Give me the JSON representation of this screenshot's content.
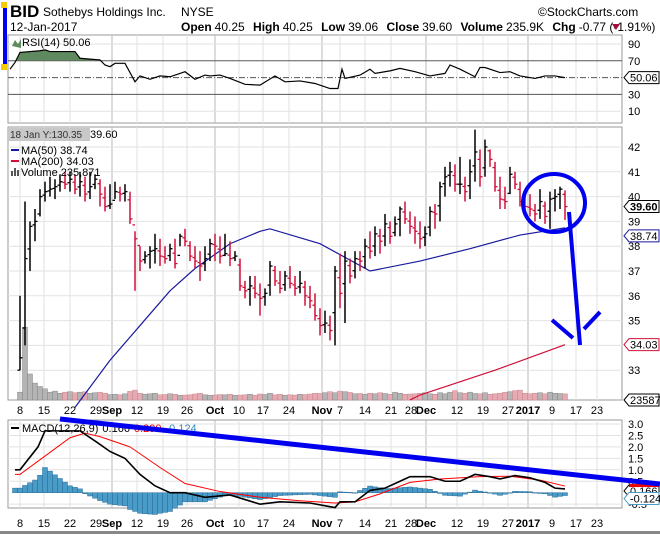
{
  "header": {
    "symbol": "BID",
    "company": "Sothebys Holdings Inc.",
    "exchange": "NYSE",
    "copyright": "©StockCharts.com",
    "date": "12-Jan-2017",
    "open_label": "Open",
    "open": "40.25",
    "high_label": "High",
    "high": "40.25",
    "low_label": "Low",
    "low": "39.06",
    "close_label": "Close",
    "close": "39.60",
    "volume_label": "Volume",
    "volume": "235.9K",
    "chg_label": "Chg",
    "chg": "-0.77 (-1.91%)",
    "chg_icon": "down-triangle-icon"
  },
  "tooltip": {
    "text": "18 Jan Y:130.35",
    "trail": "39.60"
  },
  "colors": {
    "up": "#000000",
    "down": "#d0103a",
    "ma50": "#1a1aa0",
    "ma200": "#d0103a",
    "macd": "#000000",
    "signal": "#ff0000",
    "hist": "#4a9cc8",
    "rsi_fill": "#5f8a5f",
    "annotation": "#0000ee"
  },
  "chart_data": [
    {
      "type": "line",
      "name": "rsi",
      "legend": "RSI(14) 50.06",
      "value_label": "50.06",
      "ylim": [
        0,
        100
      ],
      "yticks": [
        "90",
        "70",
        "50",
        "30",
        "10"
      ],
      "yvals": [
        90,
        70,
        50,
        30,
        10
      ],
      "overbought": 70,
      "oversold": 30,
      "points": [
        [
          -2,
          60
        ],
        [
          -1,
          68
        ],
        [
          0,
          80
        ],
        [
          4,
          82
        ],
        [
          5,
          83
        ],
        [
          6,
          81
        ],
        [
          11,
          81
        ],
        [
          12,
          73
        ],
        [
          14,
          72
        ],
        [
          16,
          71
        ],
        [
          17,
          65
        ],
        [
          18,
          63
        ],
        [
          19,
          67
        ],
        [
          21,
          67
        ],
        [
          23,
          45
        ],
        [
          24,
          52
        ],
        [
          26,
          48
        ],
        [
          28,
          52
        ],
        [
          30,
          51
        ],
        [
          32,
          55
        ],
        [
          33,
          57
        ],
        [
          35,
          48
        ],
        [
          37,
          53
        ],
        [
          38,
          52
        ],
        [
          40,
          53
        ],
        [
          42,
          49
        ],
        [
          45,
          42
        ],
        [
          48,
          41
        ],
        [
          51,
          52
        ],
        [
          53,
          45
        ],
        [
          56,
          46
        ],
        [
          59,
          43
        ],
        [
          62,
          37
        ],
        [
          63.6,
          37
        ],
        [
          64.4,
          60
        ],
        [
          65,
          49
        ],
        [
          68,
          53
        ],
        [
          70,
          60
        ],
        [
          71,
          55
        ],
        [
          74,
          58
        ],
        [
          76,
          61
        ],
        [
          79,
          57
        ],
        [
          82,
          52
        ],
        [
          85,
          55
        ],
        [
          86,
          65
        ],
        [
          88,
          60
        ],
        [
          91,
          51
        ],
        [
          92,
          62
        ],
        [
          93,
          62
        ],
        [
          96,
          56
        ],
        [
          98,
          57
        ],
        [
          100,
          52
        ],
        [
          103,
          49
        ],
        [
          105,
          52
        ],
        [
          107,
          52
        ],
        [
          109,
          50
        ]
      ]
    },
    {
      "type": "ohlc",
      "name": "price",
      "legend": {
        "ma50": "MA(50) 38.74",
        "ma200": "MA(200) 34.03",
        "volume": "Volume 235,871"
      },
      "ylim": [
        32.2,
        43
      ],
      "yticks": [
        "42",
        "41",
        "40",
        "39",
        "38",
        "37",
        "36",
        "35",
        "34",
        "33"
      ],
      "last_label": "39.60",
      "ma50_label": "38.74",
      "ma200_label": "34.03",
      "volume_label": "235871",
      "bars_hlc": [
        [
          36,
          33,
          33.5
        ],
        [
          39.8,
          34,
          37.5
        ],
        [
          39,
          37,
          38.8
        ],
        [
          39.5,
          38.2,
          39
        ],
        [
          40.3,
          39.2,
          40
        ],
        [
          40.6,
          39.8,
          40.2
        ],
        [
          40.8,
          40,
          40.3
        ],
        [
          40.7,
          39.9,
          40.4
        ],
        [
          40.9,
          40.2,
          40.6
        ],
        [
          41,
          40.3,
          40.5
        ],
        [
          41,
          40.2,
          40.7
        ],
        [
          40.9,
          40.1,
          40.3
        ],
        [
          41,
          40,
          40.6
        ],
        [
          40.8,
          39.8,
          40.1
        ],
        [
          41,
          39.9,
          40.4
        ],
        [
          40.9,
          40.3,
          40.7
        ],
        [
          40.7,
          39.6,
          40.1
        ],
        [
          40.4,
          39.4,
          39.6
        ],
        [
          40.5,
          39.5,
          39.7
        ],
        [
          40.6,
          39.9,
          40.2
        ],
        [
          40.4,
          39.8,
          40.1
        ],
        [
          40.5,
          39.8,
          40.2
        ],
        [
          40.2,
          38.9,
          39.1
        ],
        [
          38.6,
          36.2,
          38.3
        ],
        [
          38,
          37,
          37.4
        ],
        [
          37.8,
          37.3,
          37.6
        ],
        [
          38,
          37.1,
          37.8
        ],
        [
          38.5,
          37.3,
          37.9
        ],
        [
          38.3,
          37.2,
          37.6
        ],
        [
          38,
          37.3,
          37.5
        ],
        [
          38.1,
          37.4,
          37.9
        ],
        [
          38.3,
          37.1,
          37.3
        ],
        [
          38.5,
          38,
          38.4
        ],
        [
          38.7,
          38,
          38.2
        ],
        [
          38.2,
          37.4,
          37.6
        ],
        [
          38,
          37.1,
          37.4
        ],
        [
          37.8,
          36.6,
          37.2
        ],
        [
          38,
          37,
          37.5
        ],
        [
          38.3,
          37.4,
          38.1
        ],
        [
          38.5,
          37.4,
          38
        ],
        [
          38.4,
          37.3,
          37.6
        ],
        [
          38.5,
          37.6,
          37.7
        ],
        [
          38.2,
          37.2,
          37.5
        ],
        [
          37.8,
          37.4,
          37.6
        ],
        [
          37.5,
          36.2,
          36.4
        ],
        [
          36.6,
          35.9,
          36.2
        ],
        [
          36.8,
          35.6,
          36.4
        ],
        [
          36.8,
          35.9,
          36.1
        ],
        [
          36.5,
          35.2,
          35.9
        ],
        [
          36.3,
          35.6,
          36.1
        ],
        [
          37.4,
          36,
          37.2
        ],
        [
          37.2,
          36.4,
          36.6
        ],
        [
          37,
          36.1,
          36.3
        ],
        [
          37,
          36.2,
          36.8
        ],
        [
          37.2,
          36.3,
          36.5
        ],
        [
          36.8,
          36,
          36.3
        ],
        [
          37,
          36.1,
          36.5
        ],
        [
          36.6,
          35.6,
          36
        ],
        [
          36.4,
          35.5,
          35.8
        ],
        [
          36.1,
          35,
          35.2
        ],
        [
          35.5,
          34.4,
          34.8
        ],
        [
          35.4,
          34.5,
          34.9
        ],
        [
          35.2,
          34.2,
          34.6
        ],
        [
          37.2,
          34,
          37
        ],
        [
          37.7,
          35.5,
          36.1
        ],
        [
          37.8,
          34.9,
          37.4
        ],
        [
          37.5,
          36.5,
          36.8
        ],
        [
          37.8,
          36.7,
          37.5
        ],
        [
          37.8,
          37,
          37.4
        ],
        [
          38.3,
          37.1,
          38
        ],
        [
          38.6,
          37.5,
          37.8
        ],
        [
          38.8,
          37.6,
          38.5
        ],
        [
          38.7,
          37.7,
          38.2
        ],
        [
          39.3,
          38,
          38.9
        ],
        [
          39,
          38.1,
          38.4
        ],
        [
          39.2,
          38.4,
          38.9
        ],
        [
          39.6,
          38.4,
          39.5
        ],
        [
          39.8,
          38.9,
          39.1
        ],
        [
          39.4,
          38.5,
          38.8
        ],
        [
          39.2,
          38.1,
          38.6
        ],
        [
          39,
          37.9,
          38.3
        ],
        [
          38.8,
          38,
          38.5
        ],
        [
          39.6,
          38.4,
          39.4
        ],
        [
          39.7,
          38.7,
          39.3
        ],
        [
          40.6,
          39,
          40.4
        ],
        [
          41.2,
          40,
          40.8
        ],
        [
          41.4,
          40.4,
          41
        ],
        [
          41.3,
          40.2,
          40.5
        ],
        [
          41.6,
          40.1,
          40.5
        ],
        [
          40.8,
          39.8,
          40.2
        ],
        [
          41.5,
          39.9,
          41
        ],
        [
          42.7,
          40.6,
          41.8
        ],
        [
          41.9,
          40.4,
          40.8
        ],
        [
          42.3,
          40.8,
          42
        ],
        [
          41.9,
          41.2,
          41.5
        ],
        [
          41.4,
          40.2,
          40.4
        ],
        [
          40.8,
          39.5,
          39.9
        ],
        [
          40.4,
          39.5,
          39.8
        ],
        [
          41.2,
          40.1,
          40.9
        ],
        [
          41,
          40.3,
          40.5
        ],
        [
          40.6,
          39.6,
          39.8
        ],
        [
          40.2,
          39.4,
          39.6
        ],
        [
          40.1,
          39.2,
          39.5
        ],
        [
          39.7,
          39,
          39.3
        ],
        [
          40.3,
          39.1,
          39.8
        ],
        [
          39.8,
          38.9,
          39.2
        ],
        [
          40.2,
          38.7,
          39.9
        ],
        [
          40.3,
          39.4,
          40
        ],
        [
          40.4,
          39.5,
          40.3
        ],
        [
          40.25,
          39.06,
          39.6
        ]
      ],
      "ma50": [
        [
          11,
          31.5
        ],
        [
          18,
          33.4
        ],
        [
          24,
          34.8
        ],
        [
          30,
          36.2
        ],
        [
          35,
          37.1
        ],
        [
          42,
          38.1
        ],
        [
          48,
          38.6
        ],
        [
          50,
          38.7
        ],
        [
          60,
          38.1
        ],
        [
          70,
          37.0
        ],
        [
          80,
          37.4
        ],
        [
          90,
          37.9
        ],
        [
          100,
          38.45
        ],
        [
          109,
          38.74
        ]
      ],
      "ma200": [
        [
          78,
          31.8
        ],
        [
          80,
          32.0
        ],
        [
          95,
          33.0
        ],
        [
          109,
          34.03
        ]
      ],
      "volume_k": [
        300,
        2800,
        1000,
        650,
        520,
        430,
        300,
        340,
        260,
        300,
        320,
        280,
        300,
        320,
        260,
        280,
        300,
        260,
        210,
        220,
        200,
        240,
        330,
        380,
        260,
        220,
        240,
        260,
        200,
        210,
        240,
        220,
        180,
        190,
        200,
        230,
        260,
        200,
        180,
        190,
        210,
        200,
        220,
        180,
        190,
        200,
        220,
        180,
        230,
        210,
        260,
        200,
        220,
        180,
        200,
        190,
        220,
        210,
        230,
        260,
        250,
        280,
        320,
        280,
        340,
        320,
        290,
        240,
        250,
        220,
        260,
        240,
        280,
        250,
        220,
        300,
        260,
        220,
        230,
        240,
        260,
        280,
        240,
        220,
        280,
        240,
        300,
        360,
        280,
        260,
        300,
        250,
        240,
        280,
        220,
        240,
        260,
        300,
        320,
        360,
        380,
        260,
        240,
        260,
        280,
        240,
        300,
        260,
        250,
        236
      ]
    },
    {
      "type": "line",
      "name": "macd",
      "legend": {
        "label": "MACD(12,26,9)",
        "macd": "0.166",
        "signal": "0.290",
        "hist": "-0.124"
      },
      "ylim": [
        -0.8,
        3.3
      ],
      "yticks": [
        "3.0",
        "2.5",
        "2.0",
        "1.5",
        "1.0",
        "0.5",
        "-0.5"
      ],
      "yvals": [
        3.0,
        2.5,
        2.0,
        1.5,
        1.0,
        0.5,
        -0.5
      ],
      "macd": [
        [
          -1,
          1.0
        ],
        [
          0,
          1.0
        ],
        [
          3.6,
          2.0
        ],
        [
          5,
          2.7
        ],
        [
          12,
          2.7
        ],
        [
          15.4,
          2.2
        ],
        [
          18,
          1.8
        ],
        [
          21,
          1.5
        ],
        [
          24,
          0.8
        ],
        [
          27,
          0.3
        ],
        [
          30,
          0.0
        ],
        [
          33,
          0.0
        ],
        [
          37,
          -0.2
        ],
        [
          42,
          -0.1
        ],
        [
          48,
          -0.5
        ],
        [
          52,
          -0.4
        ],
        [
          58,
          -0.45
        ],
        [
          63,
          -0.65
        ],
        [
          64,
          -0.4
        ],
        [
          67,
          -0.4
        ],
        [
          70,
          0.1
        ],
        [
          73,
          0.2
        ],
        [
          76,
          0.5
        ],
        [
          78,
          0.7
        ],
        [
          82,
          0.7
        ],
        [
          85,
          0.5
        ],
        [
          88,
          0.5
        ],
        [
          91,
          0.8
        ],
        [
          94,
          0.7
        ],
        [
          96,
          0.6
        ],
        [
          99,
          0.75
        ],
        [
          102,
          0.65
        ],
        [
          105,
          0.45
        ],
        [
          107,
          0.2
        ],
        [
          109,
          0.166
        ]
      ],
      "signal": [
        [
          -1,
          0.8
        ],
        [
          0,
          0.8
        ],
        [
          5,
          1.6
        ],
        [
          10,
          2.4
        ],
        [
          13,
          2.6
        ],
        [
          16,
          2.45
        ],
        [
          22,
          2.0
        ],
        [
          28,
          1.1
        ],
        [
          33,
          0.4
        ],
        [
          40,
          0.05
        ],
        [
          48,
          -0.2
        ],
        [
          56,
          -0.35
        ],
        [
          63,
          -0.45
        ],
        [
          67,
          -0.4
        ],
        [
          72,
          -0.05
        ],
        [
          78,
          0.45
        ],
        [
          84,
          0.6
        ],
        [
          92,
          0.7
        ],
        [
          98,
          0.72
        ],
        [
          104,
          0.55
        ],
        [
          109,
          0.29
        ]
      ]
    }
  ],
  "date_axis": [
    "8",
    "15",
    "22",
    "29",
    "Sep",
    "12",
    "19",
    "26",
    "Oct",
    "10",
    "17",
    "24",
    "Nov",
    "7",
    "14",
    "21",
    "28",
    "Dec",
    "12",
    "19",
    "27",
    "2017",
    "9",
    "17",
    "23"
  ]
}
